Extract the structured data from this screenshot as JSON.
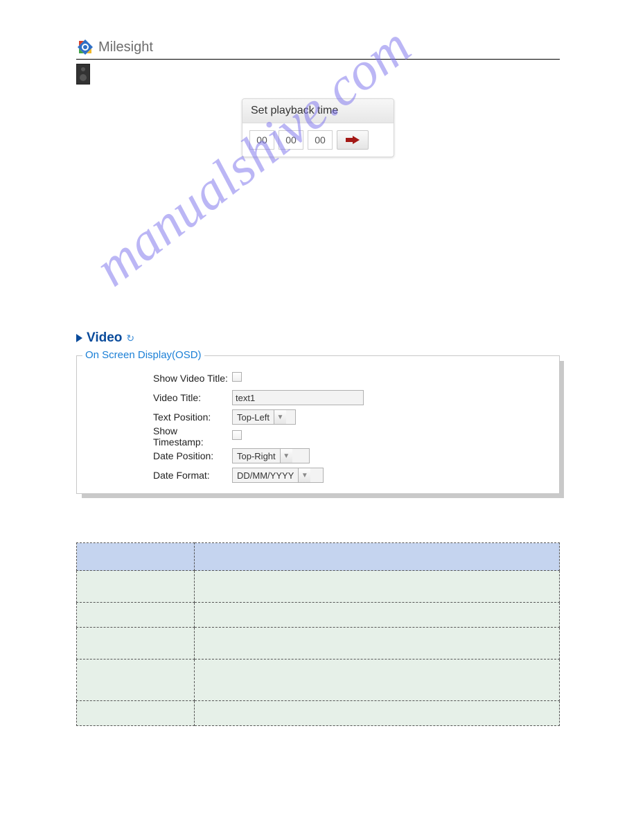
{
  "brand": {
    "name": "Milesight"
  },
  "playback": {
    "title": "Set playback time",
    "hh": "00",
    "mm": "00",
    "ss": "00"
  },
  "video": {
    "heading": "Video",
    "refresh_glyph": "↻"
  },
  "osd": {
    "legend": "On Screen Display(OSD)",
    "labels": {
      "show_title": "Show Video Title:",
      "video_title": "Video Title:",
      "text_position": "Text Position:",
      "show_timestamp": "Show Timestamp:",
      "date_position": "Date Position:",
      "date_format": "Date Format:"
    },
    "values": {
      "video_title": "text1",
      "text_position": "Top-Left",
      "date_position": "Top-Right",
      "date_format": "DD/MM/YYYY"
    }
  },
  "watermark_text": "manualshive.com"
}
